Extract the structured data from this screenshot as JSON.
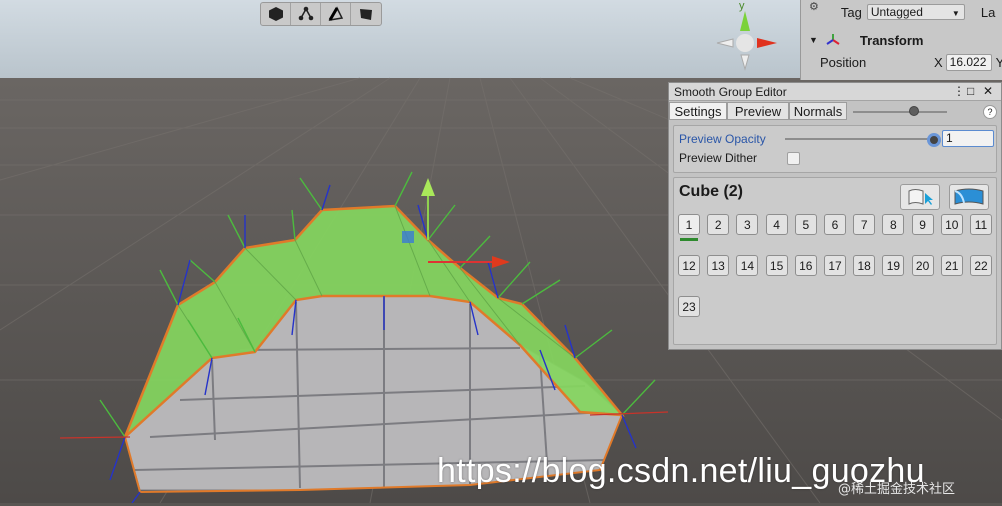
{
  "scene": {
    "toolbar": [
      {
        "name": "mesh-select-icon"
      },
      {
        "name": "vertex-select-icon"
      },
      {
        "name": "edge-select-icon"
      },
      {
        "name": "face-select-icon"
      }
    ]
  },
  "inspector": {
    "tag_label": "Tag",
    "tag_value": "Untagged",
    "layer_label_partial": "La",
    "transform_label": "Transform",
    "position_label": "Position",
    "x_label": "X",
    "x_value": "16.022",
    "y_label_partial": "Y"
  },
  "smooth_group_editor": {
    "title": "Smooth Group Editor",
    "tabs": [
      "Settings",
      "Preview",
      "Normals"
    ],
    "preview_opacity_label": "Preview Opacity",
    "preview_opacity_value": "1",
    "preview_dither_label": "Preview Dither",
    "object_name": "Cube (2)",
    "group_buttons": [
      "1",
      "2",
      "3",
      "4",
      "5",
      "6",
      "7",
      "8",
      "9",
      "10",
      "11",
      "12",
      "13",
      "14",
      "15",
      "16",
      "17",
      "18",
      "19",
      "20",
      "21",
      "22",
      "23"
    ]
  },
  "watermark": {
    "url": "https://blog.csdn.net/liu_guozhu",
    "credit": "@稀土掘金技术社区"
  },
  "colors": {
    "scene_ground": "#585552",
    "sky": "#c0ccd6",
    "face_highlight": "#84d65e",
    "edge_orange": "#e07a2a",
    "arrow_red": "#d0191e"
  }
}
